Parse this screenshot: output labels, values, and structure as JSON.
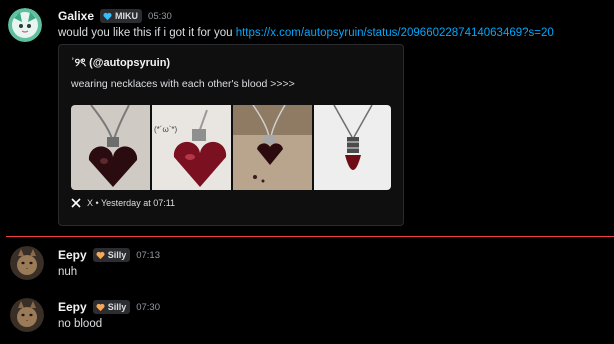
{
  "messages": [
    {
      "author": "Galixe",
      "tag": "MIKU",
      "time": "05:30",
      "text": "would you like this if i got it for you ",
      "link": "https://x.com/autopsyruin/status/2096602287414063469?s=20",
      "embed": {
        "author": "ʾ୨ৎ (@autopsyruin)",
        "description": "wearing necklaces with each other's blood >>>>",
        "footer": "X • Yesterday at 07:11",
        "image_overlay_text": "(*´ω`*)"
      }
    },
    {
      "author": "Eepy",
      "tag": "Silly",
      "time": "07:13",
      "text": "nuh"
    },
    {
      "author": "Eepy",
      "tag": "Silly",
      "time": "07:30",
      "text": "no blood"
    }
  ],
  "colors": {
    "background": "#000000",
    "link": "#00a8fc",
    "new_divider": "#f23f43",
    "miku_tag_icon": "#38bdf8",
    "silly_tag_icon": "#f5a85c"
  },
  "icons": [
    "heart-badge-icon",
    "x-logo-icon"
  ]
}
